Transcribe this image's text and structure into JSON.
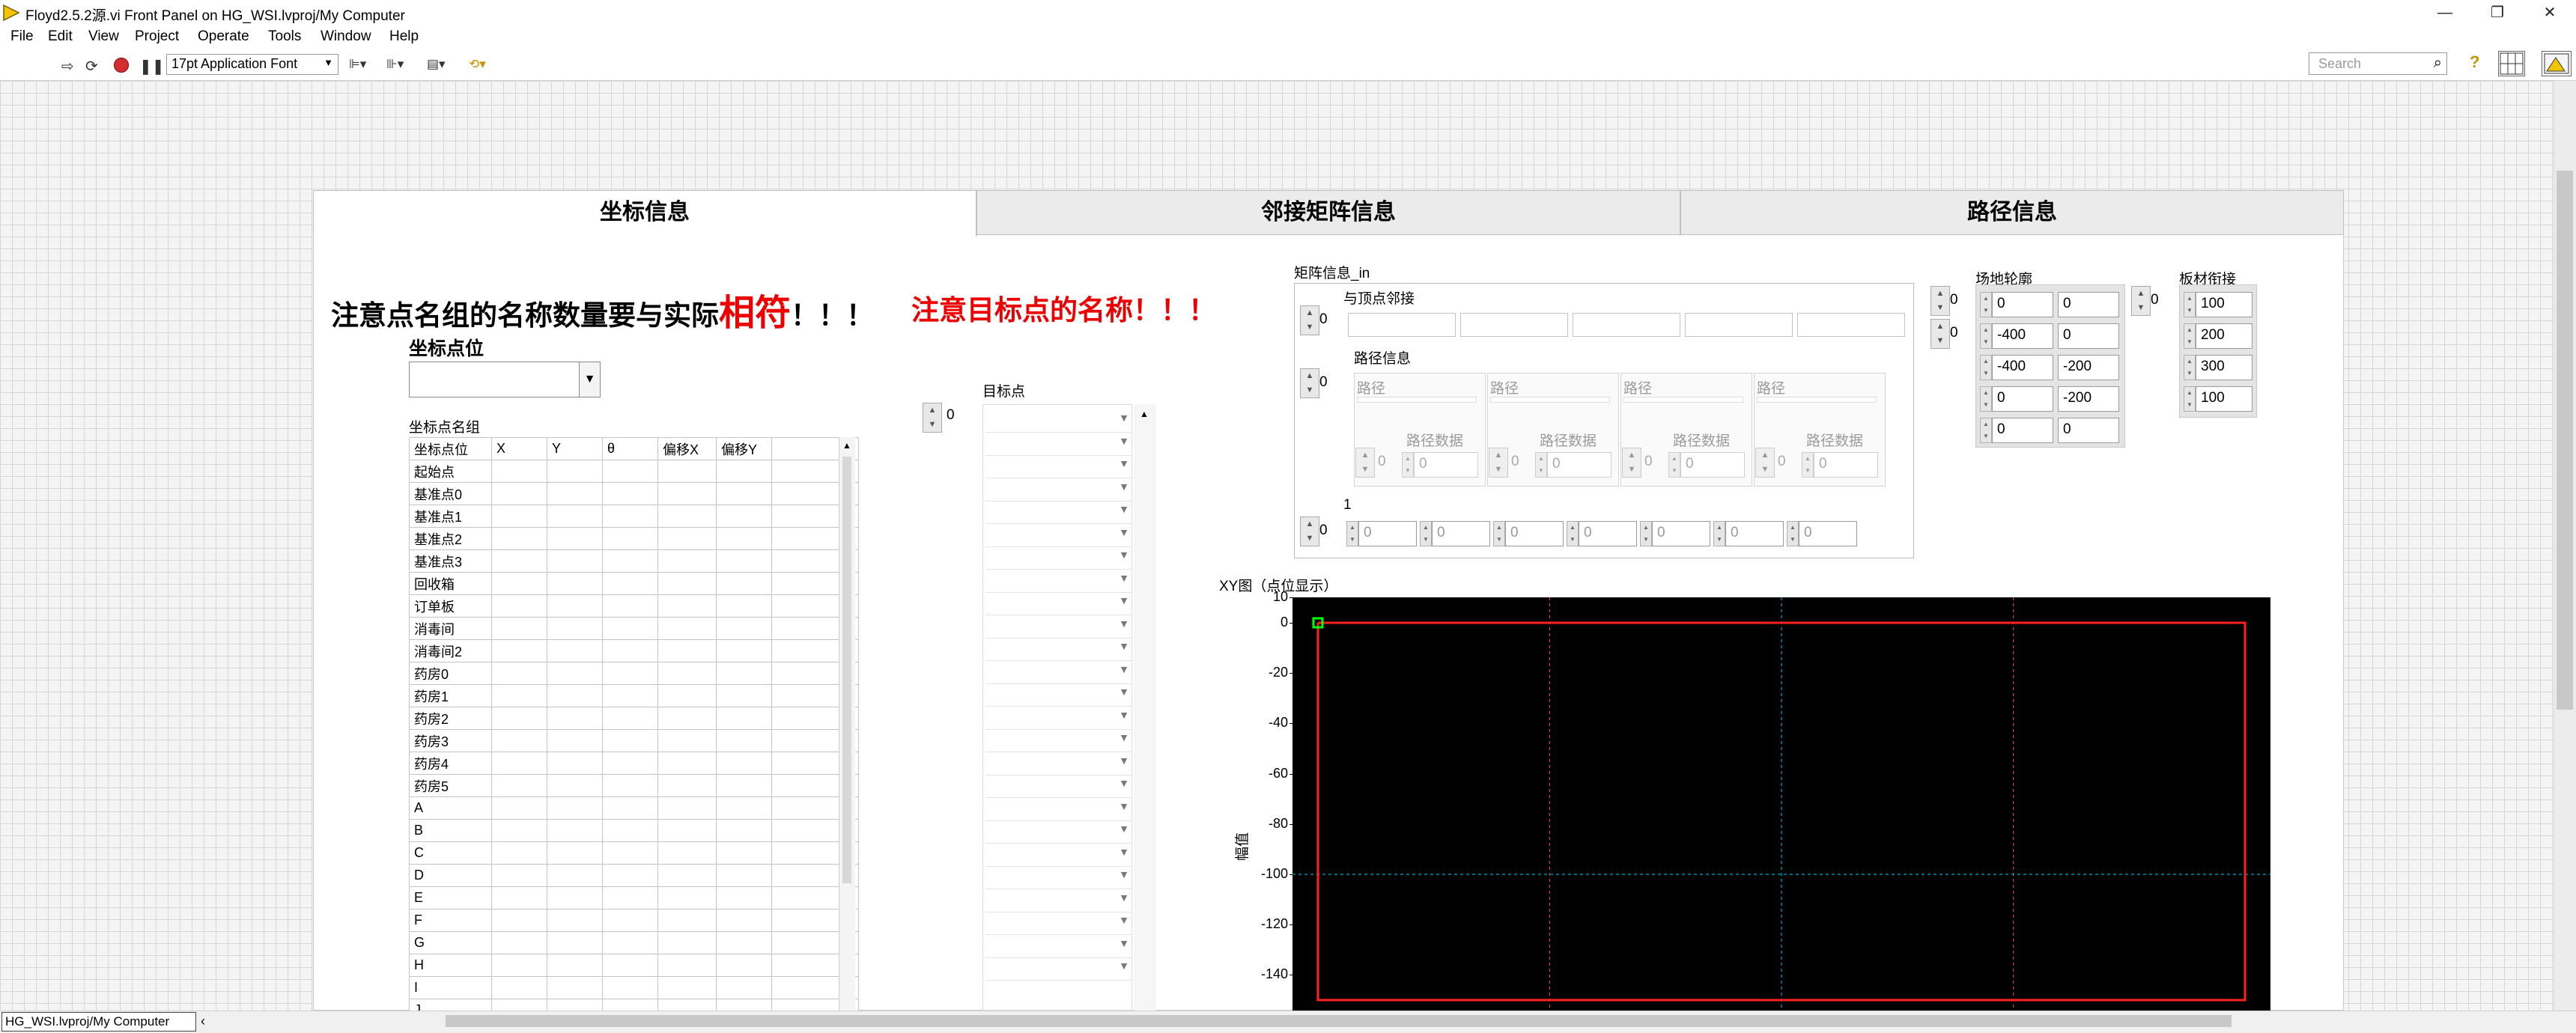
{
  "window": {
    "title": "Floyd2.5.2源.vi Front Panel on HG_WSI.lvproj/My Computer",
    "controls": [
      "—",
      "❐",
      "✕"
    ]
  },
  "menu": [
    "File",
    "Edit",
    "View",
    "Project",
    "Operate",
    "Tools",
    "Window",
    "Help"
  ],
  "toolbar": {
    "font": "17pt Application Font",
    "search_placeholder": "Search"
  },
  "tabs": [
    "坐标信息",
    "邻接矩阵信息",
    "路径信息"
  ],
  "active_tab": 0,
  "warnings": {
    "w1_pre": "注意点名组的名称数量要与实际",
    "w1_big": "相符",
    "w1_post": "！！！",
    "w2": "注意目标点的名称！！！"
  },
  "coord": {
    "point_label": "坐标点位",
    "group_label": "坐标点名组",
    "headers": [
      "坐标点位",
      "X",
      "Y",
      "θ",
      "偏移X",
      "偏移Y",
      ""
    ],
    "rows": [
      "起始点",
      "基准点0",
      "基准点1",
      "基准点2",
      "基准点3",
      "回收箱",
      "订单板",
      "消毒间",
      "消毒间2",
      "药房0",
      "药房1",
      "药房2",
      "药房3",
      "药房4",
      "药房5",
      "A",
      "B",
      "C",
      "D",
      "E",
      "F",
      "G",
      "H",
      "I",
      "J"
    ]
  },
  "target": {
    "label": "目标点",
    "index": "0"
  },
  "matrix": {
    "label": "矩阵信息_in",
    "adjacent_label": "与顶点邻接",
    "adjacent_index": "0",
    "path_info_label": "路径信息",
    "path_info_index": "0",
    "path_label": "路径",
    "path_data_label": "路径数据",
    "zero": "0",
    "one": "1",
    "row_index": "0",
    "row_values": [
      "0",
      "0",
      "0",
      "0",
      "0",
      "0",
      "0"
    ]
  },
  "field": {
    "label": "场地轮廓",
    "index1": "0",
    "index2": "0",
    "col1": [
      "0",
      "-400",
      "-400",
      "0",
      "0"
    ],
    "col2": [
      "0",
      "0",
      "-200",
      "-200",
      "0"
    ]
  },
  "board": {
    "label": "板材衔接",
    "index": "0",
    "values": [
      "100",
      "200",
      "300",
      "100"
    ]
  },
  "chart_data": {
    "type": "line",
    "title": "XY图（点位显示）",
    "ylabel": "幅值",
    "xlabel": "",
    "y_ticks": [
      "10",
      "0",
      "-20",
      "-40",
      "-60",
      "-80",
      "-100",
      "-120",
      "-140"
    ],
    "ylim": [
      -150,
      10
    ],
    "series": [
      {
        "color": "#ff2020",
        "points": [
          [
            0,
            0
          ],
          [
            400,
            0
          ],
          [
            400,
            -150
          ],
          [
            0,
            -150
          ],
          [
            0,
            0
          ]
        ]
      },
      {
        "color": "#00ff00",
        "points": [
          [
            0,
            0
          ]
        ]
      }
    ],
    "grid_color": "#ff3030",
    "cursor_color": "#00c8ff",
    "xlim": [
      0,
      400
    ]
  },
  "status": {
    "path": "HG_WSI.lvproj/My Computer"
  }
}
